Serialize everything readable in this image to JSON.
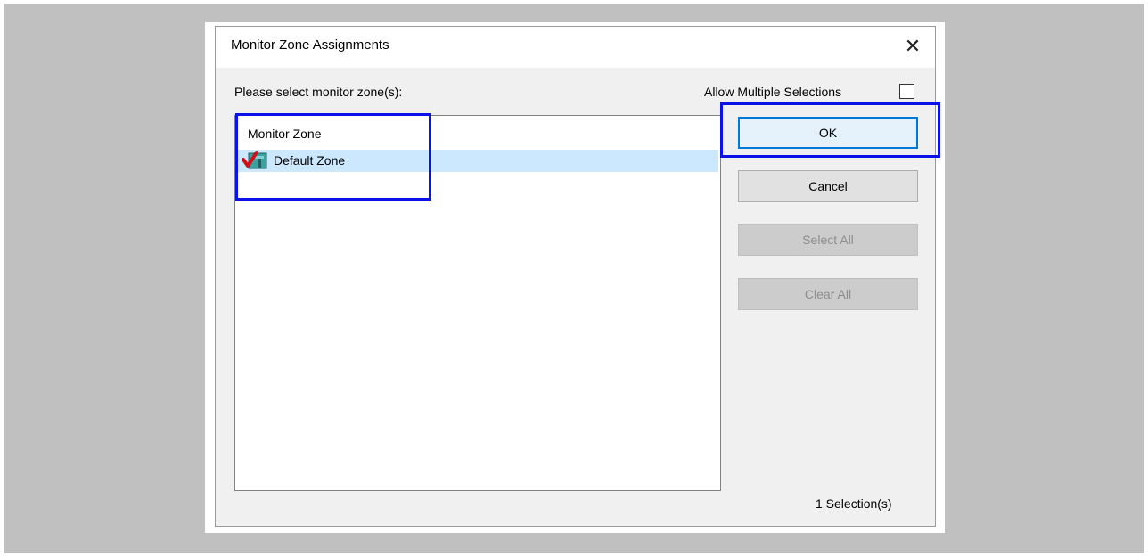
{
  "dialog": {
    "title": "Monitor Zone Assignments",
    "close_glyph": "✕"
  },
  "prompt_label": "Please select monitor zone(s):",
  "allow_multiple": {
    "label": "Allow Multiple Selections",
    "checked": false
  },
  "list": {
    "header": "Monitor Zone",
    "items": [
      {
        "label": "Default Zone",
        "icon": "checkmark-zone-icon",
        "selected": true
      }
    ]
  },
  "buttons": {
    "ok": "OK",
    "cancel": "Cancel",
    "select_all": "Select All",
    "clear_all": "Clear All"
  },
  "status": "1 Selection(s)",
  "colors": {
    "selection": "#cce8ff",
    "focus_border": "#0078d7",
    "annotation": "#0a12e8"
  }
}
